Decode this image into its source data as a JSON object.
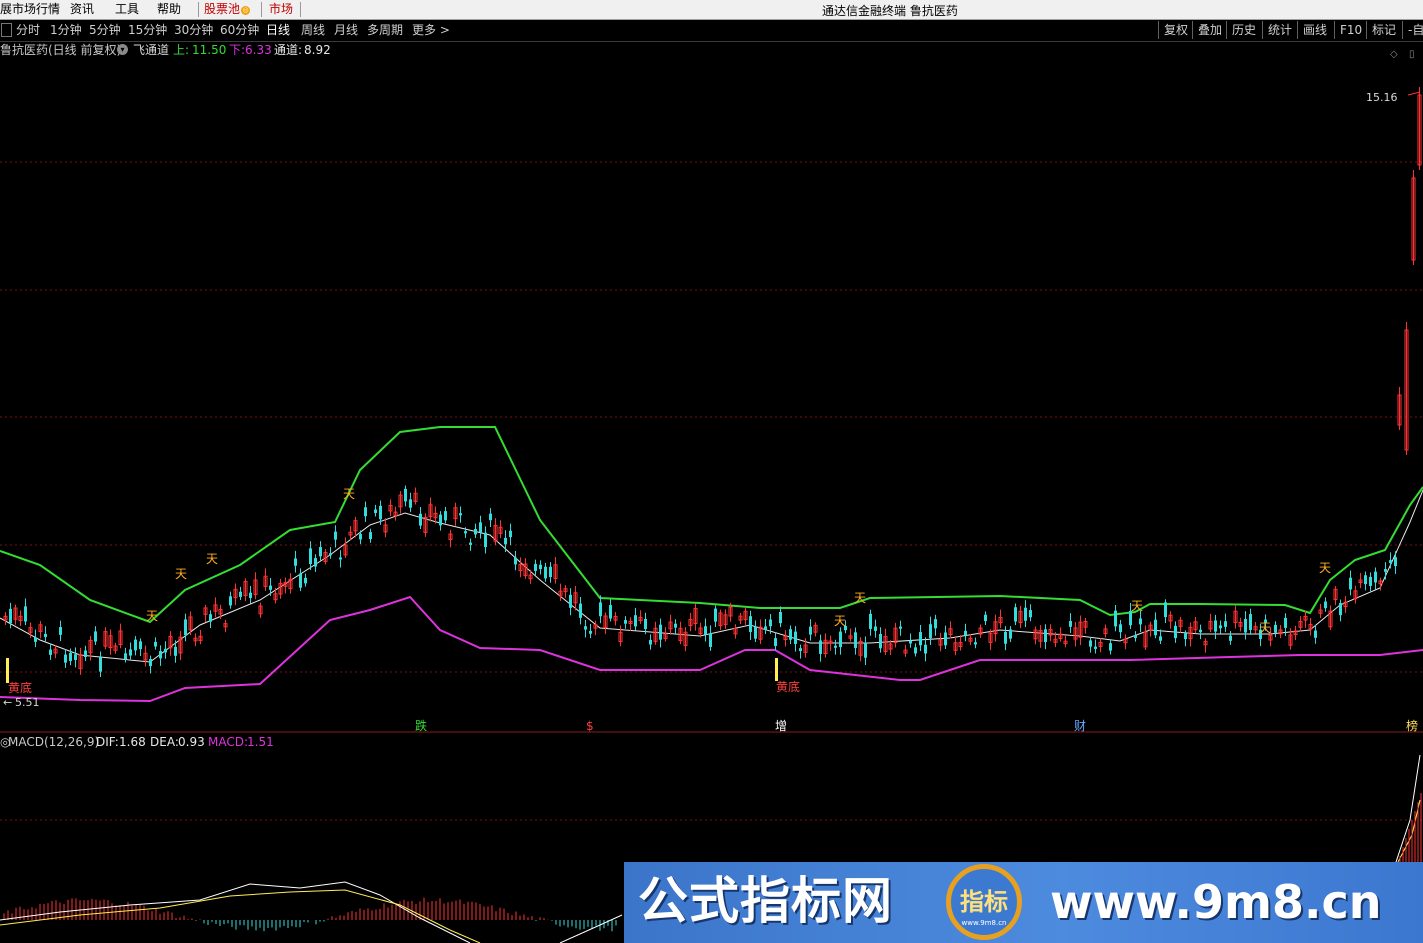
{
  "menubar": {
    "items": [
      "展市场行情",
      "资讯",
      "工具",
      "帮助"
    ],
    "stock_pool": "股票池",
    "stock_pool_badge": "◎",
    "market": "市场"
  },
  "app_title": "通达信金融终端  鲁抗医药",
  "toolbar": {
    "box_glyph": "□",
    "periods": [
      "分时",
      "1分钟",
      "5分钟",
      "15分钟",
      "30分钟",
      "60分钟",
      "日线",
      "周线",
      "月线",
      "多周期",
      "更多 >"
    ],
    "active_period": "日线",
    "right_buttons": [
      "复权",
      "叠加",
      "历史",
      "统计",
      "画线",
      "F10",
      "标记",
      "-自"
    ]
  },
  "main_chart": {
    "stock": "鲁抗医药(日线 前复权)",
    "indicator": "飞通道",
    "upper_label": "上:",
    "upper_value": "11.50",
    "lower_label": "下:",
    "lower_value": "6.33",
    "mid_label": "通道:",
    "mid_value": "8.92",
    "high_price": "15.16",
    "low_price": "5.51",
    "low_arrow": "←",
    "bottom_signal": "黄底",
    "event_marks": [
      "跌",
      "$",
      "增",
      "财",
      "榜"
    ],
    "buy_mark": "天",
    "colors": {
      "upper": "#33dd33",
      "middle": "#e8e8e8",
      "lower": "#dd33dd",
      "up_candle": "#ff3333",
      "down_candle": "#33dddd"
    }
  },
  "macd": {
    "name": "MACD(12,26,9)",
    "dif_label": "DIF:",
    "dif_value": "1.68",
    "dea_label": "DEA:",
    "dea_value": "0.93",
    "macd_label": "MACD:",
    "macd_value": "1.51"
  },
  "watermark": {
    "left_text": "公式指标网",
    "logo_text": "指标",
    "logo_sub": "www.9m8.cn",
    "right_text": "www.9m8.cn"
  },
  "chart_data": {
    "type": "line",
    "series": [
      {
        "name": "上",
        "last": 11.5
      },
      {
        "name": "下",
        "last": 6.33
      },
      {
        "name": "通道",
        "last": 8.92
      }
    ],
    "price_high": 15.16,
    "price_low": 5.51
  }
}
